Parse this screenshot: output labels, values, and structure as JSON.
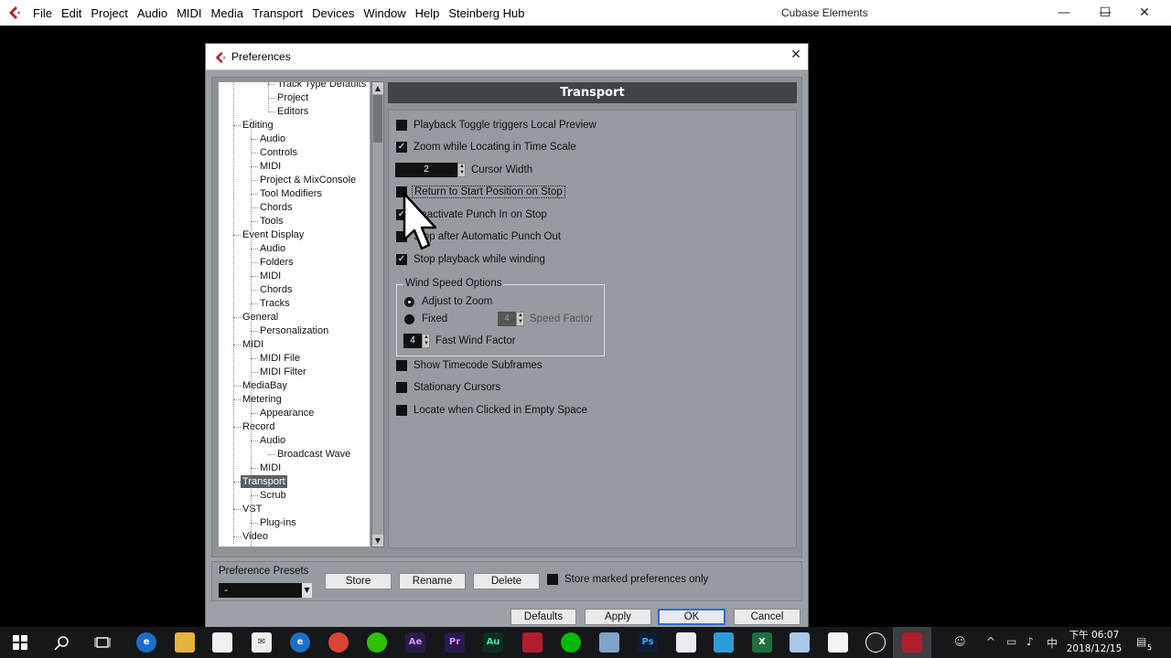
{
  "app": {
    "menu": [
      "File",
      "Edit",
      "Project",
      "Audio",
      "MIDI",
      "Media",
      "Transport",
      "Devices",
      "Window",
      "Help",
      "Steinberg Hub"
    ],
    "title": "Cubase Elements",
    "controls": {
      "minimize": "—",
      "maximize": "☐",
      "close": "✕"
    }
  },
  "dialog": {
    "title": "Preferences",
    "close": "✕"
  },
  "tree": {
    "items": [
      {
        "label": "Track Type Defaults",
        "level": 2
      },
      {
        "label": "Project",
        "level": 2
      },
      {
        "label": "Editors",
        "level": 2
      },
      {
        "label": "Editing",
        "level": 0
      },
      {
        "label": "Audio",
        "level": 1
      },
      {
        "label": "Controls",
        "level": 1
      },
      {
        "label": "MIDI",
        "level": 1
      },
      {
        "label": "Project & MixConsole",
        "level": 1
      },
      {
        "label": "Tool Modifiers",
        "level": 1
      },
      {
        "label": "Chords",
        "level": 1
      },
      {
        "label": "Tools",
        "level": 1
      },
      {
        "label": "Event Display",
        "level": 0
      },
      {
        "label": "Audio",
        "level": 1
      },
      {
        "label": "Folders",
        "level": 1
      },
      {
        "label": "MIDI",
        "level": 1
      },
      {
        "label": "Chords",
        "level": 1
      },
      {
        "label": "Tracks",
        "level": 1
      },
      {
        "label": "General",
        "level": 0
      },
      {
        "label": "Personalization",
        "level": 1
      },
      {
        "label": "MIDI",
        "level": 0
      },
      {
        "label": "MIDI File",
        "level": 1
      },
      {
        "label": "MIDI Filter",
        "level": 1
      },
      {
        "label": "MediaBay",
        "level": 0
      },
      {
        "label": "Metering",
        "level": 0
      },
      {
        "label": "Appearance",
        "level": 1
      },
      {
        "label": "Record",
        "level": 0
      },
      {
        "label": "Audio",
        "level": 1
      },
      {
        "label": "Broadcast Wave",
        "level": 2
      },
      {
        "label": "MIDI",
        "level": 1
      },
      {
        "label": "Transport",
        "level": 0,
        "selected": true
      },
      {
        "label": "Scrub",
        "level": 1
      },
      {
        "label": "VST",
        "level": 0
      },
      {
        "label": "Plug-ins",
        "level": 1
      },
      {
        "label": "Video",
        "level": 0
      }
    ]
  },
  "panel": {
    "heading": "Transport",
    "options": {
      "playback_toggle": {
        "label": "Playback Toggle triggers Local Preview",
        "checked": false
      },
      "zoom_locating": {
        "label": "Zoom while Locating in Time Scale",
        "checked": true
      },
      "cursor_width": {
        "label": "Cursor Width",
        "value": "2"
      },
      "return_start": {
        "label": "Return to Start Position on Stop",
        "checked": false
      },
      "deactivate_punch": {
        "label": "Deactivate Punch In on Stop",
        "checked": true
      },
      "stop_after_punch": {
        "label": "Stop after Automatic Punch Out",
        "checked": false
      },
      "stop_winding": {
        "label": "Stop playback while winding",
        "checked": true
      },
      "show_timecode": {
        "label": "Show Timecode Subframes",
        "checked": false
      },
      "stationary": {
        "label": "Stationary Cursors",
        "checked": false
      },
      "locate_empty": {
        "label": "Locate when Clicked in Empty Space",
        "checked": false
      }
    },
    "wind": {
      "title": "Wind Speed Options",
      "adjust": "Adjust to Zoom",
      "fixed": "Fixed",
      "speed_factor_value": "4",
      "speed_factor_label": "Speed Factor",
      "fast_wind_value": "4",
      "fast_wind_label": "Fast Wind Factor",
      "selected": "Adjust to Zoom"
    }
  },
  "footer": {
    "presets_label": "Preference Presets",
    "presets_value": "-",
    "store": "Store",
    "rename": "Rename",
    "delete": "Delete",
    "store_marked": "Store marked preferences only",
    "defaults": "Defaults",
    "apply": "Apply",
    "ok": "OK",
    "cancel": "Cancel"
  },
  "taskbar": {
    "ime": "中",
    "time": "下午 06:07",
    "date": "2018/12/15",
    "notifications": "5"
  }
}
